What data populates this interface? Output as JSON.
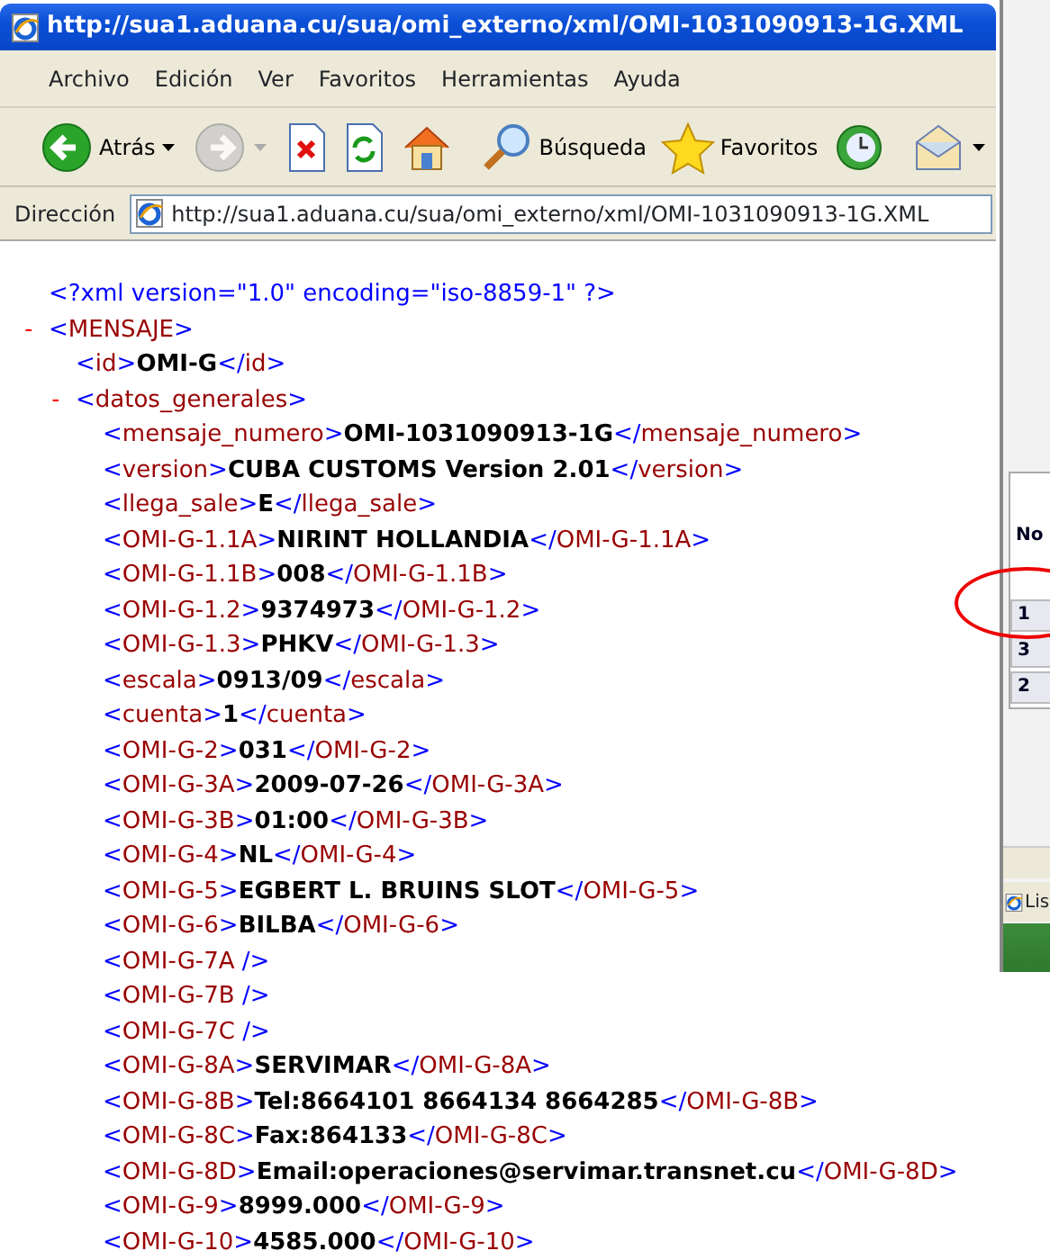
{
  "window": {
    "title": "http://sua1.aduana.cu/sua/omi_externo/xml/OMI-1031090913-1G.XML"
  },
  "menu": [
    "Archivo",
    "Edición",
    "Ver",
    "Favoritos",
    "Herramientas",
    "Ayuda"
  ],
  "toolbar": [
    {
      "kind": "back",
      "label": "Atrás",
      "disabled": false,
      "dropdown": true
    },
    {
      "kind": "forward",
      "disabled": true,
      "dropdown": true
    },
    {
      "kind": "stop"
    },
    {
      "kind": "refresh"
    },
    {
      "kind": "home"
    },
    {
      "kind": "separator"
    },
    {
      "kind": "search",
      "label": "Búsqueda"
    },
    {
      "kind": "favorites",
      "label": "Favoritos"
    },
    {
      "kind": "history"
    },
    {
      "kind": "separator"
    },
    {
      "kind": "mail",
      "dropdown": true
    }
  ],
  "address_bar": {
    "label": "Dirección",
    "value": "http://sua1.aduana.cu/sua/omi_externo/xml/OMI-1031090913-1G.XML"
  },
  "xml": {
    "declaration": "<?xml version=\"1.0\" encoding=\"iso-8859-1\" ?>",
    "nodes": [
      {
        "kind": "element",
        "toggle": "-",
        "open_tag": "<MENSAJE>",
        "expanded": true,
        "children": [
          {
            "kind": "text",
            "open_tag": "<id>",
            "value": "OMI-G",
            "close_tag": "</id>"
          },
          {
            "kind": "element",
            "toggle": "-",
            "open_tag": "<datos_generales>",
            "expanded": true,
            "children": [
              {
                "kind": "text",
                "open_tag": "<mensaje_numero>",
                "value": "OMI-1031090913-1G",
                "close_tag": "</mensaje_numero>"
              },
              {
                "kind": "text",
                "open_tag": "<version>",
                "value": "CUBA CUSTOMS Version 2.01",
                "close_tag": "</version>"
              },
              {
                "kind": "text",
                "open_tag": "<llega_sale>",
                "value": "E",
                "close_tag": "</llega_sale>"
              },
              {
                "kind": "text",
                "open_tag": "<OMI-G-1.1A>",
                "value": "NIRINT HOLLANDIA",
                "close_tag": "</OMI-G-1.1A>"
              },
              {
                "kind": "text",
                "open_tag": "<OMI-G-1.1B>",
                "value": "008",
                "close_tag": "</OMI-G-1.1B>"
              },
              {
                "kind": "text",
                "open_tag": "<OMI-G-1.2>",
                "value": "9374973",
                "close_tag": "</OMI-G-1.2>"
              },
              {
                "kind": "text",
                "open_tag": "<OMI-G-1.3>",
                "value": "PHKV",
                "close_tag": "</OMI-G-1.3>"
              },
              {
                "kind": "text",
                "open_tag": "<escala>",
                "value": "0913/09",
                "close_tag": "</escala>"
              },
              {
                "kind": "text",
                "open_tag": "<cuenta>",
                "value": "1",
                "close_tag": "</cuenta>"
              },
              {
                "kind": "text",
                "open_tag": "<OMI-G-2>",
                "value": "031",
                "close_tag": "</OMI-G-2>"
              },
              {
                "kind": "text",
                "open_tag": "<OMI-G-3A>",
                "value": "2009-07-26",
                "close_tag": "</OMI-G-3A>"
              },
              {
                "kind": "text",
                "open_tag": "<OMI-G-3B>",
                "value": "01:00",
                "close_tag": "</OMI-G-3B>"
              },
              {
                "kind": "text",
                "open_tag": "<OMI-G-4>",
                "value": "NL",
                "close_tag": "</OMI-G-4>"
              },
              {
                "kind": "text",
                "open_tag": "<OMI-G-5>",
                "value": "EGBERT L. BRUINS SLOT",
                "close_tag": "</OMI-G-5>"
              },
              {
                "kind": "text",
                "open_tag": "<OMI-G-6>",
                "value": "BILBA",
                "close_tag": "</OMI-G-6>"
              },
              {
                "kind": "empty",
                "open_tag": "<OMI-G-7A />"
              },
              {
                "kind": "empty",
                "open_tag": "<OMI-G-7B />"
              },
              {
                "kind": "empty",
                "open_tag": "<OMI-G-7C />"
              },
              {
                "kind": "text",
                "open_tag": "<OMI-G-8A>",
                "value": "SERVIMAR",
                "close_tag": "</OMI-G-8A>"
              },
              {
                "kind": "text",
                "open_tag": "<OMI-G-8B>",
                "value": "Tel:8664101 8664134 8664285",
                "close_tag": "</OMI-G-8B>"
              },
              {
                "kind": "text",
                "open_tag": "<OMI-G-8C>",
                "value": "Fax:864133",
                "close_tag": "</OMI-G-8C>"
              },
              {
                "kind": "text",
                "open_tag": "<OMI-G-8D>",
                "value": "Email:operaciones@servimar.transnet.cu",
                "close_tag": "</OMI-G-8D>"
              },
              {
                "kind": "text",
                "open_tag": "<OMI-G-9>",
                "value": "8999.000",
                "close_tag": "</OMI-G-9>"
              },
              {
                "kind": "text",
                "open_tag": "<OMI-G-10>",
                "value": "4585.000",
                "close_tag": "</OMI-G-10>"
              }
            ]
          }
        ]
      }
    ]
  },
  "background_window": {
    "table_header": "No",
    "rows": [
      {
        "cell": "1",
        "circled": true
      },
      {
        "cell": "3",
        "circled": false
      },
      {
        "cell": "2",
        "circled": false
      }
    ],
    "status_text": "Lis"
  }
}
